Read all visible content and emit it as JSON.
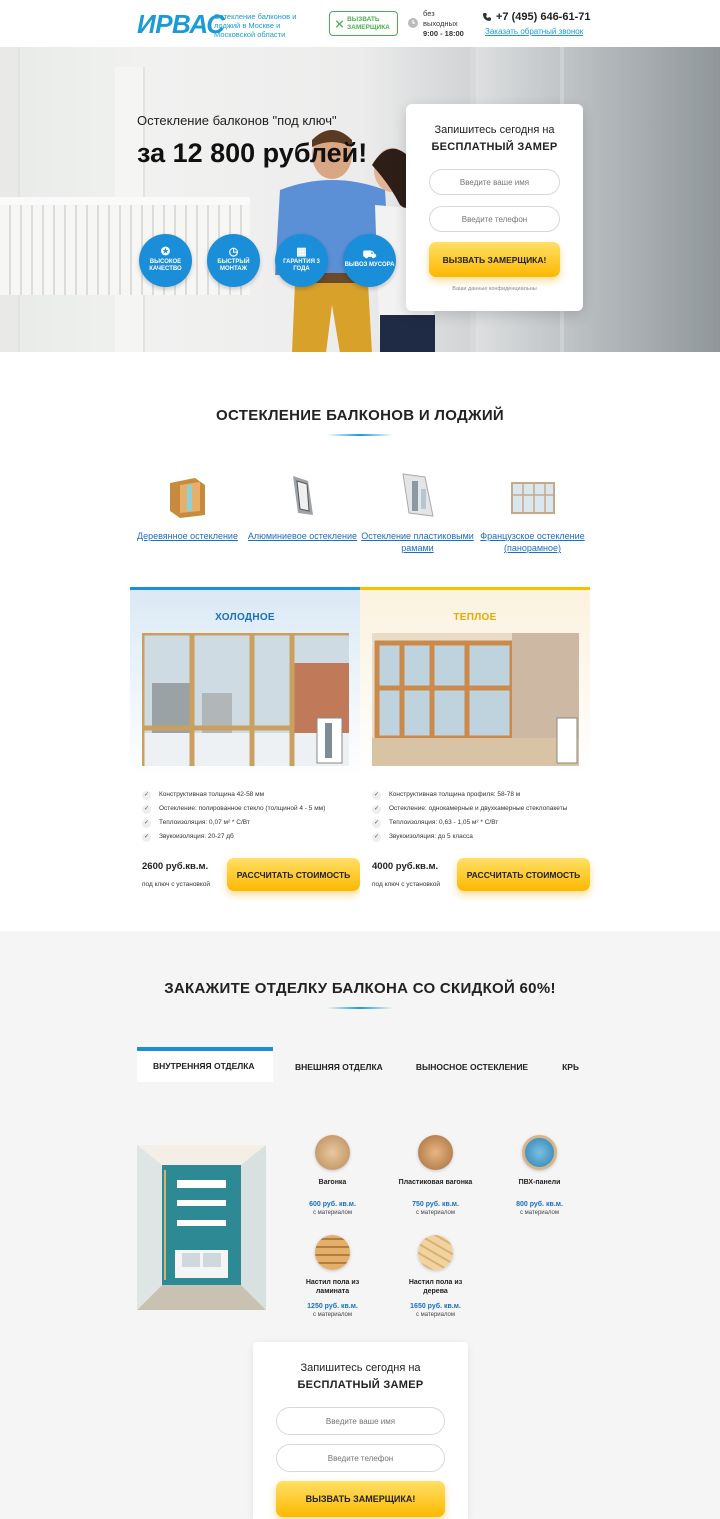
{
  "header": {
    "logo": "ИРВАС",
    "tagline": "Остекление балконов и лоджий в Москве и Московской области",
    "call_button": "ВЫЗВАТЬ ЗАМЕРЩИКА",
    "hours_label": "без выходных",
    "hours_value": "9:00 - 18:00",
    "phone": "+7 (495) 646-61-71",
    "callback_link": "Заказать обратный звонок",
    "accent_color": "#1a9ad6"
  },
  "hero": {
    "subtitle": "Остекление балконов \"под ключ\"",
    "title": "за 12 800 рублей!",
    "badges": [
      {
        "icon": "medal-icon",
        "label": "ВЫСОКОЕ КАЧЕСТВО"
      },
      {
        "icon": "clock-icon",
        "label": "БЫСТРЫЙ МОНТАЖ"
      },
      {
        "icon": "calendar-icon",
        "label": "ГАРАНТИЯ 3 ГОДА"
      },
      {
        "icon": "truck-icon",
        "label": "ВЫВОЗ МУСОРА"
      }
    ]
  },
  "form1": {
    "line1": "Запишитесь сегодня на",
    "line2": "БЕСПЛАТНЫЙ ЗАМЕР",
    "name_placeholder": "Введите ваше имя",
    "phone_placeholder": "Введите телефон",
    "submit": "ВЫЗВАТЬ ЗАМЕРЩИКА!",
    "privacy": "Ваши данные конфиденциальны"
  },
  "glazing": {
    "title": "ОСТЕКЛЕНИЕ БАЛКОНОВ И ЛОДЖИЙ",
    "types": [
      {
        "label": "Деревянное остекление"
      },
      {
        "label": "Алюминиевое остекление"
      },
      {
        "label": "Остекление пластиковыми рамами"
      },
      {
        "label": "Французское остекление (панорамное)"
      }
    ],
    "cold": {
      "title": "ХОЛОДНОЕ",
      "features": [
        "Конструктивная толщина 42-58 мм",
        "Остекление: полированное стекло (толщиной 4 - 5 мм)",
        "Теплоизоляция: 0,07 м² * С/Вт",
        "Звукоизоляция: 20-27 дб"
      ],
      "price": "2600 руб.кв.м.",
      "price_note": "под ключ с установкой",
      "button": "РАССЧИТАТЬ СТОИМОСТЬ"
    },
    "warm": {
      "title": "ТЕПЛОЕ",
      "features": [
        "Конструктивная толщина профиля: 58-78 м",
        "Остекление: однокамерные и двухкамерные стеклопакеты",
        "Теплоизоляция: 0,63 - 1,05 м² * С/Вт",
        "Звукоизоляция: до 5 класса"
      ],
      "price": "4000 руб.кв.м.",
      "price_note": "под ключ с установкой",
      "button": "РАССЧИТАТЬ СТОИМОСТЬ"
    }
  },
  "finish": {
    "title": "ЗАКАЖИТЕ ОТДЕЛКУ БАЛКОНА СО СКИДКОЙ 60%!",
    "tabs": [
      "ВНУТРЕННЯЯ ОТДЕЛКА",
      "ВНЕШНЯЯ ОТДЕЛКА",
      "ВЫНОСНОЕ ОСТЕКЛЕНИЕ",
      "КРЫ"
    ],
    "materials": [
      {
        "name": "Вагонка",
        "price": "600 руб. кв.м.",
        "note": "с материалом"
      },
      {
        "name": "Пластиковая вагонка",
        "price": "750 руб. кв.м.",
        "note": "с материалом"
      },
      {
        "name": "ПВХ-панели",
        "price": "800 руб. кв.м.",
        "note": "с материалом"
      },
      {
        "name": "Настил пола из ламината",
        "price": "1250 руб. кв.м.",
        "note": "с материалом"
      },
      {
        "name": "Настил пола из дерева",
        "price": "1650 руб. кв.м.",
        "note": "с материалом"
      }
    ]
  },
  "form2": {
    "line1": "Запишитесь сегодня на",
    "line2": "БЕСПЛАТНЫЙ ЗАМЕР",
    "name_placeholder": "Введите ваше имя",
    "phone_placeholder": "Введите телефон",
    "submit": "ВЫЗВАТЬ ЗАМЕРЩИКА!"
  }
}
